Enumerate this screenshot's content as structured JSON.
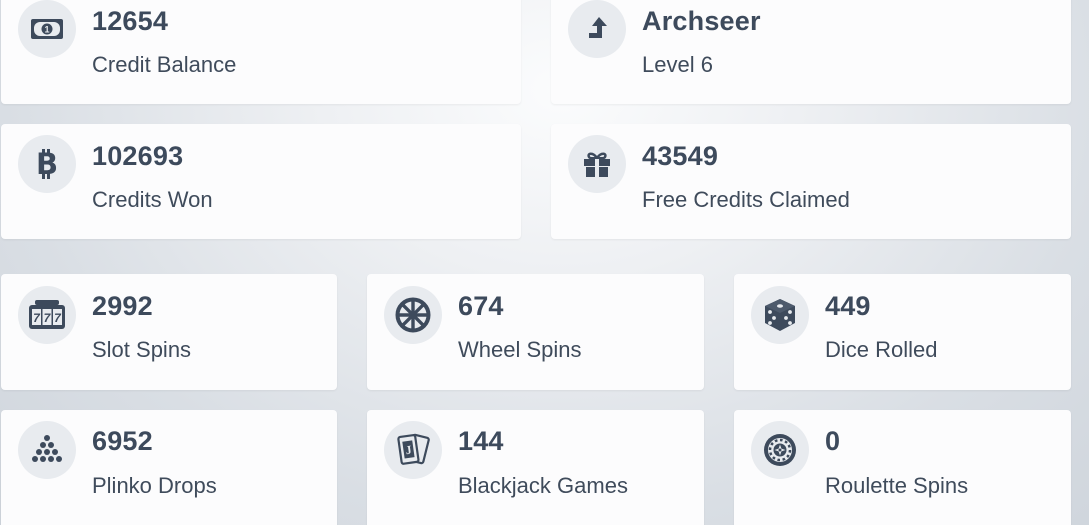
{
  "stats": {
    "credit_balance": {
      "value": "12654",
      "label": "Credit Balance",
      "icon": "money-bill-icon"
    },
    "player": {
      "value": "Archseer",
      "label": "Level 6",
      "icon": "level-up-icon"
    },
    "credits_won": {
      "value": "102693",
      "label": "Credits Won",
      "icon": "bitcoin-icon"
    },
    "free_credits": {
      "value": "43549",
      "label": "Free Credits Claimed",
      "icon": "gift-icon"
    },
    "slot_spins": {
      "value": "2992",
      "label": "Slot Spins",
      "icon": "slot-machine-icon"
    },
    "wheel_spins": {
      "value": "674",
      "label": "Wheel Spins",
      "icon": "wheel-icon"
    },
    "dice_rolled": {
      "value": "449",
      "label": "Dice Rolled",
      "icon": "dice-icon"
    },
    "plinko_drops": {
      "value": "6952",
      "label": "Plinko Drops",
      "icon": "plinko-icon"
    },
    "blackjack_games": {
      "value": "144",
      "label": "Blackjack Games",
      "icon": "playing-cards-icon"
    },
    "roulette_spins": {
      "value": "0",
      "label": "Roulette Spins",
      "icon": "roulette-icon"
    }
  },
  "colors": {
    "card": "#fcfcfd",
    "icon_bg": "#e8ebef",
    "icon_fg": "#3d4a5c",
    "text": "#3d4a5c"
  }
}
